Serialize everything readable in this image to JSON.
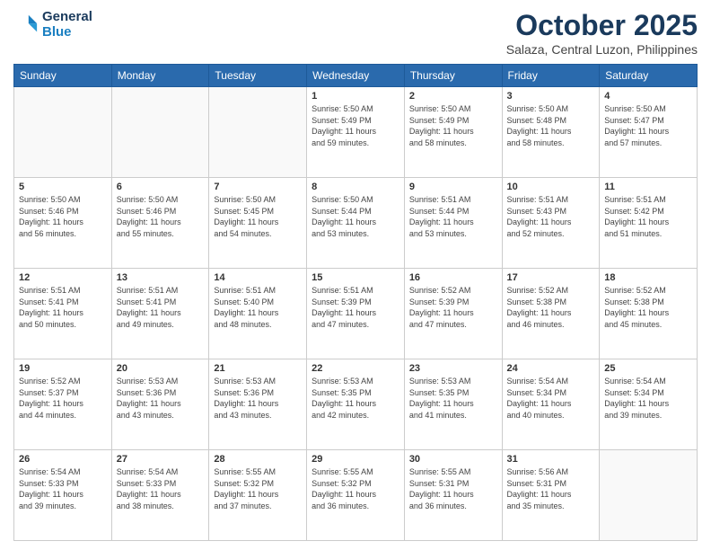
{
  "header": {
    "logo_line1": "General",
    "logo_line2": "Blue",
    "month": "October 2025",
    "location": "Salaza, Central Luzon, Philippines"
  },
  "weekdays": [
    "Sunday",
    "Monday",
    "Tuesday",
    "Wednesday",
    "Thursday",
    "Friday",
    "Saturday"
  ],
  "weeks": [
    [
      {
        "day": "",
        "info": ""
      },
      {
        "day": "",
        "info": ""
      },
      {
        "day": "",
        "info": ""
      },
      {
        "day": "1",
        "info": "Sunrise: 5:50 AM\nSunset: 5:49 PM\nDaylight: 11 hours\nand 59 minutes."
      },
      {
        "day": "2",
        "info": "Sunrise: 5:50 AM\nSunset: 5:49 PM\nDaylight: 11 hours\nand 58 minutes."
      },
      {
        "day": "3",
        "info": "Sunrise: 5:50 AM\nSunset: 5:48 PM\nDaylight: 11 hours\nand 58 minutes."
      },
      {
        "day": "4",
        "info": "Sunrise: 5:50 AM\nSunset: 5:47 PM\nDaylight: 11 hours\nand 57 minutes."
      }
    ],
    [
      {
        "day": "5",
        "info": "Sunrise: 5:50 AM\nSunset: 5:46 PM\nDaylight: 11 hours\nand 56 minutes."
      },
      {
        "day": "6",
        "info": "Sunrise: 5:50 AM\nSunset: 5:46 PM\nDaylight: 11 hours\nand 55 minutes."
      },
      {
        "day": "7",
        "info": "Sunrise: 5:50 AM\nSunset: 5:45 PM\nDaylight: 11 hours\nand 54 minutes."
      },
      {
        "day": "8",
        "info": "Sunrise: 5:50 AM\nSunset: 5:44 PM\nDaylight: 11 hours\nand 53 minutes."
      },
      {
        "day": "9",
        "info": "Sunrise: 5:51 AM\nSunset: 5:44 PM\nDaylight: 11 hours\nand 53 minutes."
      },
      {
        "day": "10",
        "info": "Sunrise: 5:51 AM\nSunset: 5:43 PM\nDaylight: 11 hours\nand 52 minutes."
      },
      {
        "day": "11",
        "info": "Sunrise: 5:51 AM\nSunset: 5:42 PM\nDaylight: 11 hours\nand 51 minutes."
      }
    ],
    [
      {
        "day": "12",
        "info": "Sunrise: 5:51 AM\nSunset: 5:41 PM\nDaylight: 11 hours\nand 50 minutes."
      },
      {
        "day": "13",
        "info": "Sunrise: 5:51 AM\nSunset: 5:41 PM\nDaylight: 11 hours\nand 49 minutes."
      },
      {
        "day": "14",
        "info": "Sunrise: 5:51 AM\nSunset: 5:40 PM\nDaylight: 11 hours\nand 48 minutes."
      },
      {
        "day": "15",
        "info": "Sunrise: 5:51 AM\nSunset: 5:39 PM\nDaylight: 11 hours\nand 47 minutes."
      },
      {
        "day": "16",
        "info": "Sunrise: 5:52 AM\nSunset: 5:39 PM\nDaylight: 11 hours\nand 47 minutes."
      },
      {
        "day": "17",
        "info": "Sunrise: 5:52 AM\nSunset: 5:38 PM\nDaylight: 11 hours\nand 46 minutes."
      },
      {
        "day": "18",
        "info": "Sunrise: 5:52 AM\nSunset: 5:38 PM\nDaylight: 11 hours\nand 45 minutes."
      }
    ],
    [
      {
        "day": "19",
        "info": "Sunrise: 5:52 AM\nSunset: 5:37 PM\nDaylight: 11 hours\nand 44 minutes."
      },
      {
        "day": "20",
        "info": "Sunrise: 5:53 AM\nSunset: 5:36 PM\nDaylight: 11 hours\nand 43 minutes."
      },
      {
        "day": "21",
        "info": "Sunrise: 5:53 AM\nSunset: 5:36 PM\nDaylight: 11 hours\nand 43 minutes."
      },
      {
        "day": "22",
        "info": "Sunrise: 5:53 AM\nSunset: 5:35 PM\nDaylight: 11 hours\nand 42 minutes."
      },
      {
        "day": "23",
        "info": "Sunrise: 5:53 AM\nSunset: 5:35 PM\nDaylight: 11 hours\nand 41 minutes."
      },
      {
        "day": "24",
        "info": "Sunrise: 5:54 AM\nSunset: 5:34 PM\nDaylight: 11 hours\nand 40 minutes."
      },
      {
        "day": "25",
        "info": "Sunrise: 5:54 AM\nSunset: 5:34 PM\nDaylight: 11 hours\nand 39 minutes."
      }
    ],
    [
      {
        "day": "26",
        "info": "Sunrise: 5:54 AM\nSunset: 5:33 PM\nDaylight: 11 hours\nand 39 minutes."
      },
      {
        "day": "27",
        "info": "Sunrise: 5:54 AM\nSunset: 5:33 PM\nDaylight: 11 hours\nand 38 minutes."
      },
      {
        "day": "28",
        "info": "Sunrise: 5:55 AM\nSunset: 5:32 PM\nDaylight: 11 hours\nand 37 minutes."
      },
      {
        "day": "29",
        "info": "Sunrise: 5:55 AM\nSunset: 5:32 PM\nDaylight: 11 hours\nand 36 minutes."
      },
      {
        "day": "30",
        "info": "Sunrise: 5:55 AM\nSunset: 5:31 PM\nDaylight: 11 hours\nand 36 minutes."
      },
      {
        "day": "31",
        "info": "Sunrise: 5:56 AM\nSunset: 5:31 PM\nDaylight: 11 hours\nand 35 minutes."
      },
      {
        "day": "",
        "info": ""
      }
    ]
  ]
}
